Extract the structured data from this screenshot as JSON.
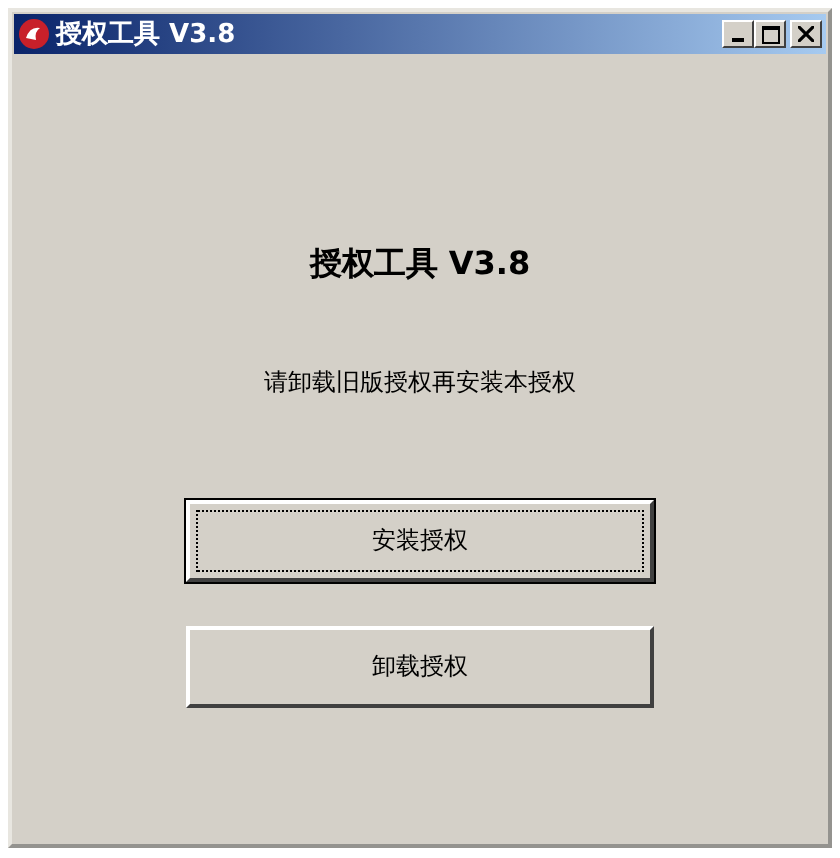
{
  "window": {
    "title": "授权工具 V3.8"
  },
  "heading": "授权工具 V3.8",
  "instruction": "请卸载旧版授权再安装本授权",
  "buttons": [
    {
      "label": "安装授权",
      "focused": true
    },
    {
      "label": "卸载授权",
      "focused": false
    }
  ]
}
